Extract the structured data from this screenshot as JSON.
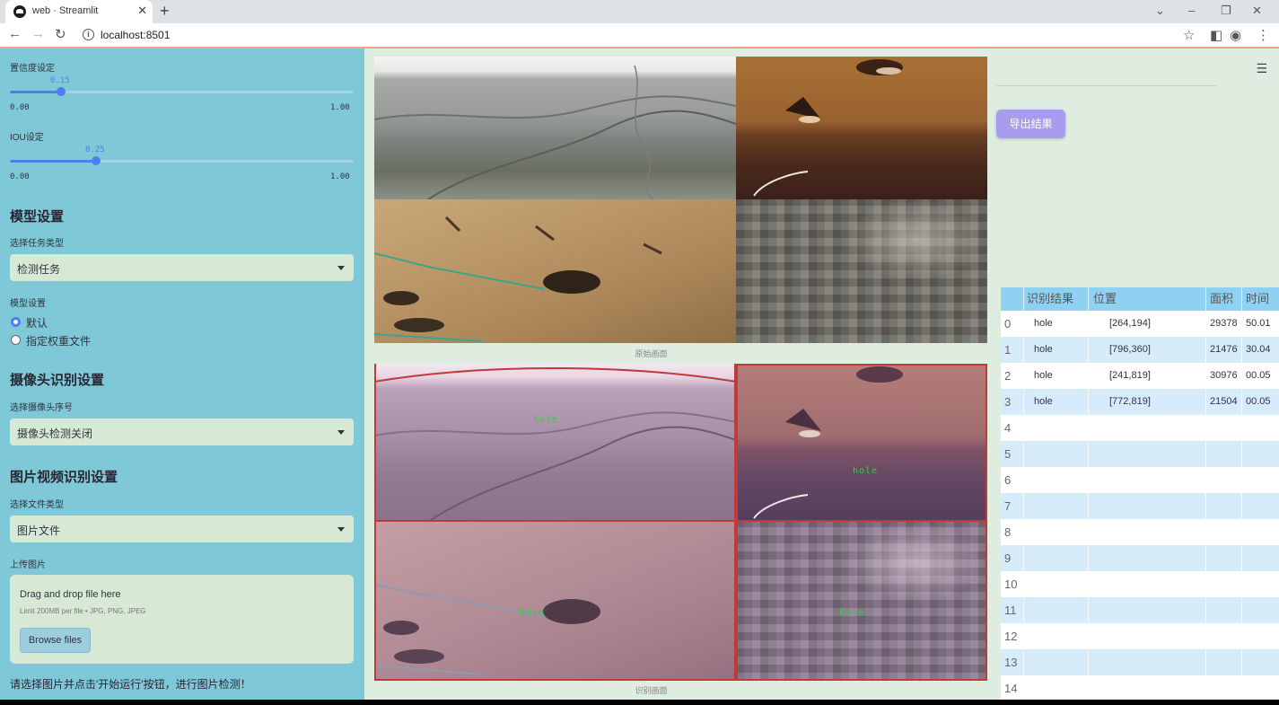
{
  "browser": {
    "tab_title": "web · Streamlit",
    "url": "localhost:8501"
  },
  "sidebar": {
    "confidence": {
      "label": "置信度设定",
      "value": "0.15",
      "fraction": 0.15,
      "min": "0.00",
      "max": "1.00"
    },
    "iou": {
      "label": "IOU设定",
      "value": "0.25",
      "fraction": 0.25,
      "min": "0.00",
      "max": "1.00"
    },
    "model_section": "模型设置",
    "task_label": "选择任务类型",
    "task_value": "检测任务",
    "model_label": "模型设置",
    "radio_default": "默认",
    "radio_custom": "指定权重文件",
    "camera_section": "摄像头识别设置",
    "camera_label": "选择摄像头序号",
    "camera_value": "摄像头检测关闭",
    "media_section": "图片视频识别设置",
    "file_type_label": "选择文件类型",
    "file_type_value": "图片文件",
    "upload_label": "上传图片",
    "dropzone_title": "Drag and drop file here",
    "dropzone_limit": "Limit 200MB per file • JPG, PNG, JPEG",
    "browse_label": "Browse files",
    "footer_hint": "请选择图片并点击'开始运行'按钮，进行图片检测！"
  },
  "main": {
    "original_caption": "原始画面",
    "result_caption": "识别画面",
    "detection_label": "hole",
    "export_label": "导出结果"
  },
  "table": {
    "headers": [
      "识别结果",
      "位置",
      "面积",
      "时间"
    ],
    "rows": [
      {
        "index": "0",
        "result": "hole",
        "position": "[264,194]",
        "area": "29378",
        "time": "50.01"
      },
      {
        "index": "1",
        "result": "hole",
        "position": "[796,360]",
        "area": "21476",
        "time": "30.04"
      },
      {
        "index": "2",
        "result": "hole",
        "position": "[241,819]",
        "area": "30976",
        "time": "00.05"
      },
      {
        "index": "3",
        "result": "hole",
        "position": "[772,819]",
        "area": "21504",
        "time": "00.05"
      }
    ],
    "empty_indices": [
      "4",
      "5",
      "6",
      "7",
      "8",
      "9",
      "10",
      "11",
      "12",
      "13",
      "14"
    ]
  },
  "colors": {
    "sidebar_bg": "#7ec8d8",
    "main_bg": "#dfece0",
    "accent": "#4d7ff2",
    "export_button": "#a99cf0",
    "detection_box": "#c0393b",
    "detection_text": "#2bd23b",
    "table_header": "#8ed1f2",
    "table_stripe": "#d6ecfb"
  }
}
